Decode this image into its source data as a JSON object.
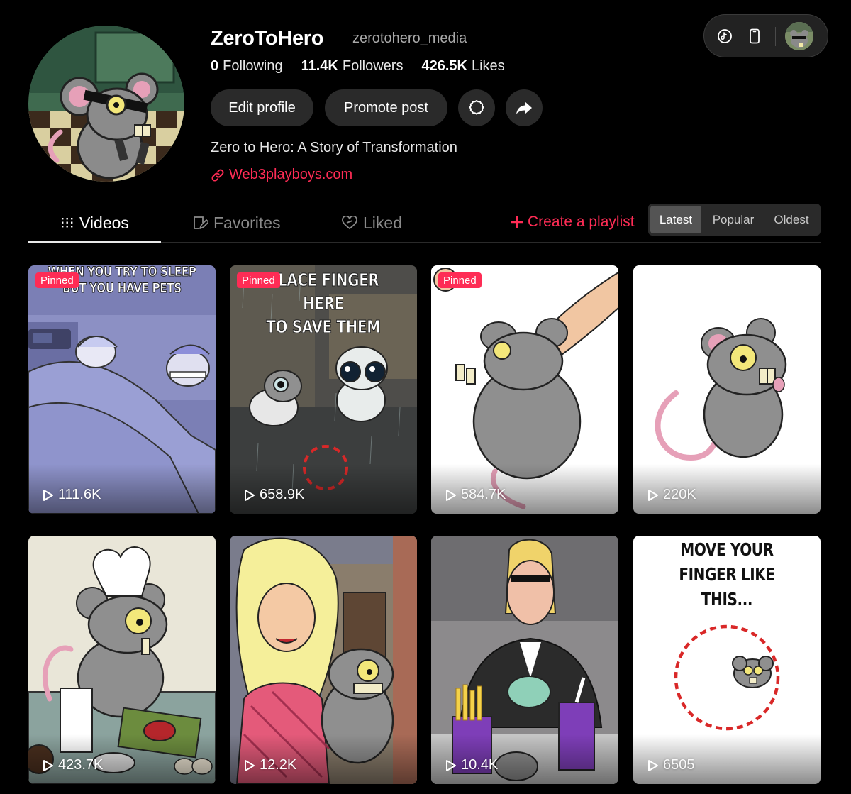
{
  "profile": {
    "username": "ZeroToHero",
    "handle": "zerotohero_media",
    "stats": {
      "following": {
        "value": "0",
        "label": "Following"
      },
      "followers": {
        "value": "11.4K",
        "label": "Followers"
      },
      "likes": {
        "value": "426.5K",
        "label": "Likes"
      }
    },
    "edit_label": "Edit profile",
    "promote_label": "Promote post",
    "bio": "Zero to Hero: A Story of Transformation",
    "link": "Web3playboys.com"
  },
  "toolbar": {
    "icons": [
      "tiktok-icon",
      "mobile-icon"
    ]
  },
  "tabs": [
    {
      "label": "Videos",
      "icon": "grid-icon",
      "active": true
    },
    {
      "label": "Favorites",
      "icon": "bookmark-icon",
      "active": false
    },
    {
      "label": "Liked",
      "icon": "heart-icon",
      "active": false
    }
  ],
  "playlist": {
    "label": "Create a playlist"
  },
  "sort": {
    "options": [
      "Latest",
      "Popular",
      "Oldest"
    ],
    "selected": "Latest"
  },
  "videos": [
    {
      "views": "111.6K",
      "pinned": true,
      "caption": [
        "WHEN YOU TRY TO SLEEP",
        "BUT YOU HAVE PETS"
      ]
    },
    {
      "views": "658.9K",
      "pinned": true,
      "caption": [
        "PLACE FINGER HERE",
        "TO SAVE THEM"
      ]
    },
    {
      "views": "584.7K",
      "pinned": true
    },
    {
      "views": "220K",
      "pinned": false
    },
    {
      "views": "423.7K",
      "pinned": false
    },
    {
      "views": "12.2K",
      "pinned": false
    },
    {
      "views": "10.4K",
      "pinned": false
    },
    {
      "views": "6505",
      "pinned": false,
      "caption": [
        "MOVE YOUR",
        "FINGER LIKE",
        "THIS..."
      ]
    }
  ],
  "pinned_label": "Pinned",
  "colors": {
    "accent": "#fe2c55",
    "background": "#000000",
    "button": "#2a2a2a"
  }
}
